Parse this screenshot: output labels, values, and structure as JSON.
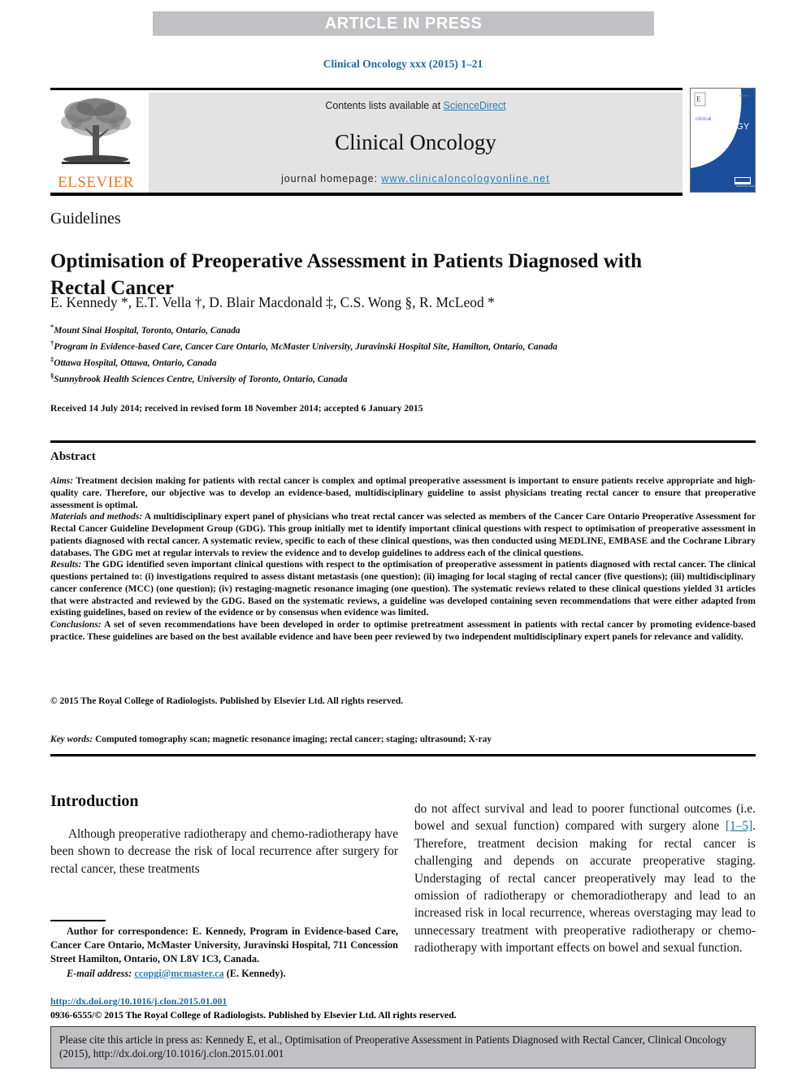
{
  "banner": {
    "text": "ARTICLE IN PRESS"
  },
  "running_citation": "Clinical Oncology xxx (2015) 1–21",
  "masthead": {
    "publisher_name": "ELSEVIER",
    "contents_prefix": "Contents lists available at ",
    "contents_link": "ScienceDirect",
    "journal_name": "Clinical Oncology",
    "homepage_prefix": "journal homepage: ",
    "homepage_link": "www.clinicaloncologyonline.net",
    "cover_title_small": "clinical",
    "cover_title_large": "ONCOLOGY"
  },
  "article": {
    "category": "Guidelines",
    "title": "Optimisation of Preoperative Assessment in Patients Diagnosed with Rectal Cancer",
    "authors": "E. Kennedy *, E.T. Vella †, D. Blair Macdonald ‡, C.S. Wong §, R. McLeod *",
    "affiliations": [
      {
        "symbol": "*",
        "text": "Mount Sinai Hospital, Toronto, Ontario, Canada"
      },
      {
        "symbol": "†",
        "text": "Program in Evidence-based Care, Cancer Care Ontario, McMaster University, Juravinski Hospital Site, Hamilton, Ontario, Canada"
      },
      {
        "symbol": "‡",
        "text": "Ottawa Hospital, Ottawa, Ontario, Canada"
      },
      {
        "symbol": "§",
        "text": "Sunnybrook Health Sciences Centre, University of Toronto, Ontario, Canada"
      }
    ],
    "history": "Received 14 July 2014; received in revised form 18 November 2014; accepted 6 January 2015"
  },
  "abstract": {
    "heading": "Abstract",
    "aims_label": "Aims:",
    "aims_text": " Treatment decision making for patients with rectal cancer is complex and optimal preoperative assessment is important to ensure patients receive appropriate and high-quality care. Therefore, our objective was to develop an evidence-based, multidisciplinary guideline to assist physicians treating rectal cancer to ensure that preoperative assessment is optimal.",
    "methods_label": "Materials and methods:",
    "methods_text": " A multidisciplinary expert panel of physicians who treat rectal cancer was selected as members of the Cancer Care Ontario Preoperative Assessment for Rectal Cancer Guideline Development Group (GDG). This group initially met to identify important clinical questions with respect to optimisation of preoperative assessment in patients diagnosed with rectal cancer. A systematic review, specific to each of these clinical questions, was then conducted using MEDLINE, EMBASE and the Cochrane Library databases. The GDG met at regular intervals to review the evidence and to develop guidelines to address each of the clinical questions.",
    "results_label": "Results:",
    "results_text": " The GDG identified seven important clinical questions with respect to the optimisation of preoperative assessment in patients diagnosed with rectal cancer. The clinical questions pertained to: (i) investigations required to assess distant metastasis (one question); (ii) imaging for local staging of rectal cancer (five questions); (iii) multidisciplinary cancer conference (MCC) (one question); (iv) restaging-magnetic resonance imaging (one question). The systematic reviews related to these clinical questions yielded 31 articles that were abstracted and reviewed by the GDG. Based on the systematic reviews, a guideline was developed containing seven recommendations that were either adapted from existing guidelines, based on review of the evidence or by consensus when evidence was limited.",
    "conclusions_label": "Conclusions:",
    "conclusions_text": " A set of seven recommendations have been developed in order to optimise pretreatment assessment in patients with rectal cancer by promoting evidence-based practice. These guidelines are based on the best available evidence and have been peer reviewed by two independent multidisciplinary expert panels for relevance and validity.",
    "copyright": "© 2015 The Royal College of Radiologists. Published by Elsevier Ltd. All rights reserved.",
    "keywords_label": "Key words:",
    "keywords_text": " Computed tomography scan; magnetic resonance imaging; rectal cancer; staging; ultrasound; X-ray"
  },
  "body": {
    "intro_heading": "Introduction",
    "intro_left": "Although preoperative radiotherapy and chemo-radiotherapy have been shown to decrease the risk of local recurrence after surgery for rectal cancer, these treatments",
    "intro_right_part1": "do not affect survival and lead to poorer functional outcomes (i.e. bowel and sexual function) compared with surgery alone ",
    "intro_right_ref": "[1–5]",
    "intro_right_part2": ". Therefore, treatment decision making for rectal cancer is challenging and depends on accurate preoperative staging. Understaging of rectal cancer preoperatively may lead to the omission of radiotherapy or chemoradiotherapy and lead to an increased risk in local recurrence, whereas overstaging may lead to unnecessary treatment with preoperative radiotherapy or chemo-radiotherapy with important effects on bowel and sexual function."
  },
  "footnote": {
    "correspondence": "Author for correspondence: E. Kennedy, Program in Evidence-based Care, Cancer Care Ontario, McMaster University, Juravinski Hospital, 711 Concession Street Hamilton, Ontario, ON L8V 1C3, Canada.",
    "email_label": "E-mail address:",
    "email": "ccopgi@mcmaster.ca",
    "email_suffix": " (E. Kennedy)."
  },
  "footer": {
    "doi": "http://dx.doi.org/10.1016/j.clon.2015.01.001",
    "issn_line": "0936-6555/© 2015 The Royal College of Radiologists. Published by Elsevier Ltd. All rights reserved.",
    "citation_box": "Please cite this article in press as: Kennedy E, et al., Optimisation of Preoperative Assessment in Patients Diagnosed with Rectal Cancer, Clinical Oncology (2015), http://dx.doi.org/10.1016/j.clon.2015.01.001"
  },
  "colors": {
    "banner_gray": "#c1c1c3",
    "journal_box_gray": "#e3e3e3",
    "link_blue": "#2a7fb8",
    "heading_blue": "#1a6aa0",
    "elsevier_orange": "#e87722",
    "cover_blue": "#1b4f9c"
  }
}
